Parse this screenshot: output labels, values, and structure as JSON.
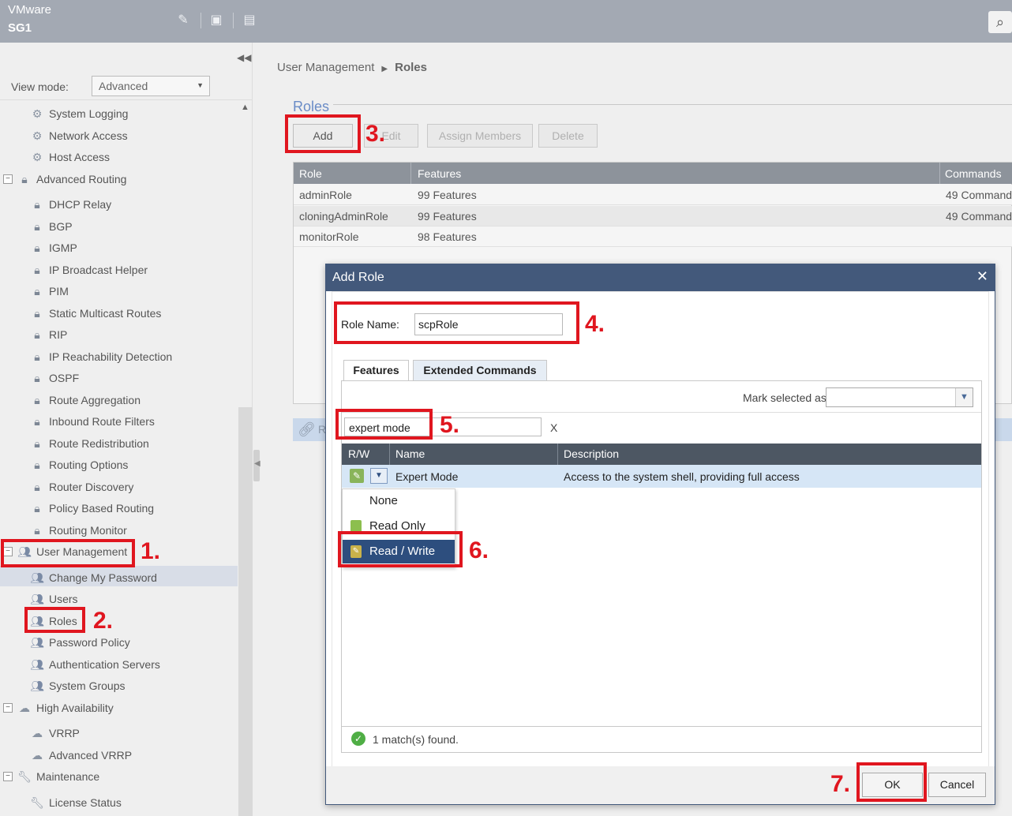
{
  "header": {
    "vendor": "VMware",
    "host": "SG1",
    "icons": [
      "pencil-icon",
      "terminal-icon",
      "document-icon",
      "search-icon"
    ]
  },
  "sidebar": {
    "view_mode_label": "View mode:",
    "view_mode_value": "Advanced",
    "items": [
      {
        "label": "System Logging",
        "icon": "gear-icon"
      },
      {
        "label": "Network Access",
        "icon": "gear-icon"
      },
      {
        "label": "Host Access",
        "icon": "gear-icon"
      },
      {
        "label": "Advanced Routing",
        "icon": "lock-icon",
        "group": true
      },
      {
        "label": "DHCP Relay",
        "icon": "lock-icon"
      },
      {
        "label": "BGP",
        "icon": "lock-icon"
      },
      {
        "label": "IGMP",
        "icon": "lock-icon"
      },
      {
        "label": "IP Broadcast Helper",
        "icon": "lock-icon"
      },
      {
        "label": "PIM",
        "icon": "lock-icon"
      },
      {
        "label": "Static Multicast Routes",
        "icon": "lock-icon"
      },
      {
        "label": "RIP",
        "icon": "lock-icon"
      },
      {
        "label": "IP Reachability Detection",
        "icon": "lock-icon"
      },
      {
        "label": "OSPF",
        "icon": "lock-icon"
      },
      {
        "label": "Route Aggregation",
        "icon": "lock-icon"
      },
      {
        "label": "Inbound Route Filters",
        "icon": "lock-icon"
      },
      {
        "label": "Route Redistribution",
        "icon": "lock-icon"
      },
      {
        "label": "Routing Options",
        "icon": "lock-icon"
      },
      {
        "label": "Router Discovery",
        "icon": "lock-icon"
      },
      {
        "label": "Policy Based Routing",
        "icon": "lock-icon"
      },
      {
        "label": "Routing Monitor",
        "icon": "lock-icon"
      },
      {
        "label": "User Management",
        "icon": "users-icon",
        "group": true
      },
      {
        "label": "Change My Password",
        "icon": "users-icon"
      },
      {
        "label": "Users",
        "icon": "users-icon"
      },
      {
        "label": "Roles",
        "icon": "users-icon",
        "selected": true
      },
      {
        "label": "Password Policy",
        "icon": "users-icon"
      },
      {
        "label": "Authentication Servers",
        "icon": "users-icon"
      },
      {
        "label": "System Groups",
        "icon": "users-icon"
      },
      {
        "label": "High Availability",
        "icon": "cloud-icon",
        "group": true
      },
      {
        "label": "VRRP",
        "icon": "cloud-icon"
      },
      {
        "label": "Advanced VRRP",
        "icon": "cloud-icon"
      },
      {
        "label": "Maintenance",
        "icon": "wrench-icon",
        "group": true
      },
      {
        "label": "License Status",
        "icon": "wrench-icon"
      }
    ]
  },
  "main": {
    "breadcrumb": {
      "parent": "User Management",
      "current": "Roles"
    },
    "section_title": "Roles",
    "toolbar": {
      "add": "Add",
      "edit": "Edit",
      "assign": "Assign Members",
      "delete": "Delete"
    },
    "table": {
      "columns": [
        "Role",
        "Features",
        "Commands"
      ],
      "rows": [
        [
          "adminRole",
          "99 Features",
          "49 Command"
        ],
        [
          "cloningAdminRole",
          "99 Features",
          "49 Command"
        ],
        [
          "monitorRole",
          "98 Features",
          ""
        ]
      ]
    },
    "bottom_strip_text": "R"
  },
  "dialog": {
    "title": "Add Role",
    "close": "✕",
    "role_name_label": "Role Name:",
    "role_name_value": "scpRole",
    "tabs": [
      "Features",
      "Extended Commands"
    ],
    "mark_selected_label": "Mark selected as:",
    "mark_selected_value": "",
    "filter_value": "expert mode",
    "filter_clear": "X",
    "columns": [
      "R/W",
      "Name",
      "Description"
    ],
    "row": {
      "name": "Expert Mode",
      "description": "Access to the system shell, providing full access"
    },
    "rw_options": [
      {
        "label": "None",
        "icon": ""
      },
      {
        "label": "Read Only",
        "icon": "read-only-icon"
      },
      {
        "label": "Read / Write",
        "icon": "read-write-icon",
        "selected": true
      }
    ],
    "status": "1 match(s) found.",
    "ok": "OK",
    "cancel": "Cancel"
  },
  "annotations": [
    "1.",
    "2.",
    "3.",
    "4.",
    "5.",
    "6.",
    "7."
  ],
  "colors": {
    "annotation": "#e0161f",
    "dialog_title": "#43597b",
    "selected_menu": "#2d4e7e",
    "section_title": "#6a8cc7"
  }
}
